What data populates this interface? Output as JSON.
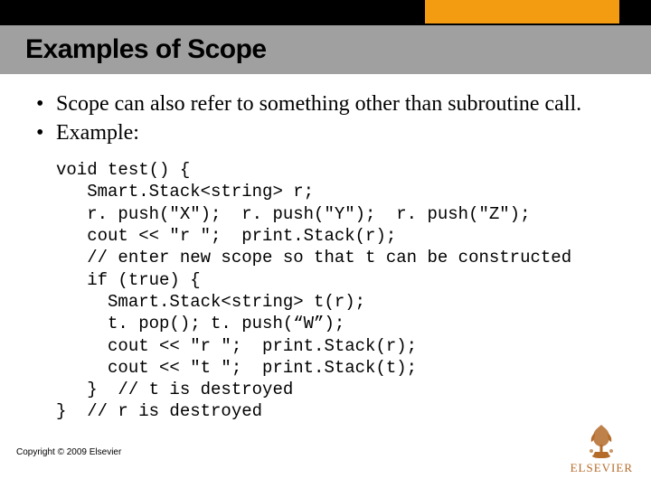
{
  "title": "Examples of Scope",
  "bullets": [
    "Scope can also refer to something other than subroutine call.",
    "Example:"
  ],
  "code": "void test() {\n   Smart.Stack<string> r;\n   r. push(\"X\");  r. push(\"Y\");  r. push(\"Z\");\n   cout << \"r \";  print.Stack(r);\n   // enter new scope so that t can be constructed\n   if (true) {\n     Smart.Stack<string> t(r);\n     t. pop(); t. push(“W”);\n     cout << \"r \";  print.Stack(r);\n     cout << \"t \";  print.Stack(t);\n   }  // t is destroyed\n}  // r is destroyed",
  "copyright": "Copyright © 2009 Elsevier",
  "logo_text": "ELSEVIER"
}
